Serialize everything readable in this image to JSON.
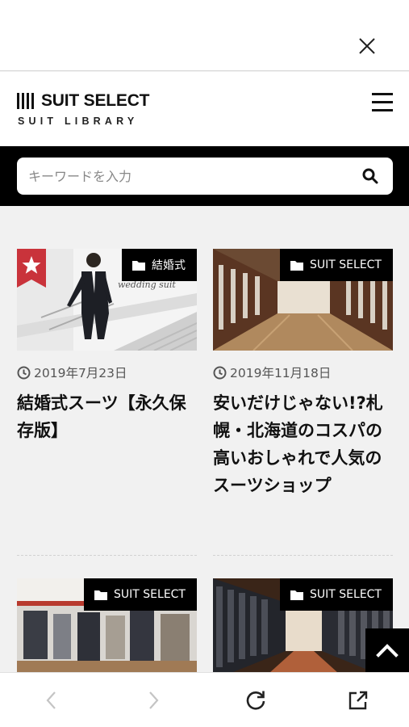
{
  "topbar": {
    "close_icon": "close-icon"
  },
  "header": {
    "brand": "SUIT SELECT",
    "subtitle": "SUIT LIBRARY",
    "menu_icon": "hamburger-menu-icon"
  },
  "search": {
    "placeholder": "キーワードを入力",
    "value": "",
    "icon": "search-icon"
  },
  "articles": [
    {
      "category": "結婚式",
      "date": "2019年7月23日",
      "title": "結婚式スーツ【永久保存版】",
      "featured": true,
      "thumb_caption": "wedding suit"
    },
    {
      "category": "SUIT SELECT",
      "date": "2019年11月18日",
      "title": "安いだけじゃない!?札幌・北海道のコスパの高いおしゃれで人気のスーツショップ",
      "featured": false
    },
    {
      "category": "SUIT SELECT",
      "featured": false
    },
    {
      "category": "SUIT SELECT",
      "featured": false
    }
  ],
  "bottom_nav": {
    "back_icon": "chevron-left-icon",
    "forward_icon": "chevron-right-icon",
    "reload_icon": "reload-icon",
    "external_icon": "open-external-icon",
    "back_enabled": false,
    "forward_enabled": false
  },
  "colors": {
    "badge_bg": "#000000",
    "star_badge": "#c9333b",
    "page_bg": "#f1f1f1"
  }
}
